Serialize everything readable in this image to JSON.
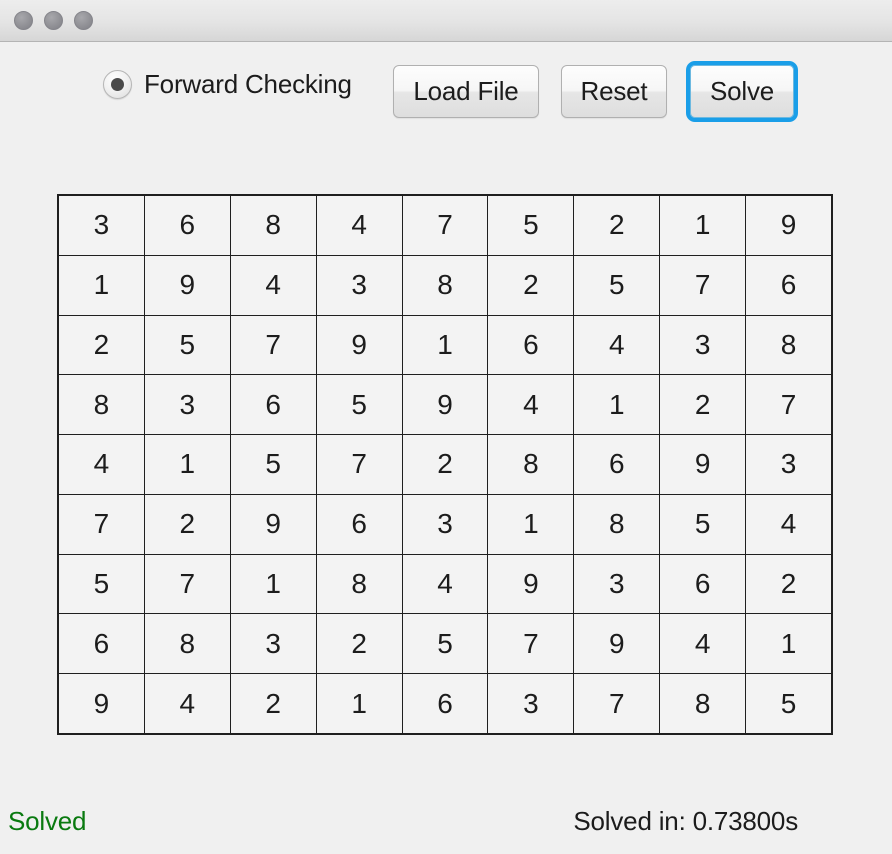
{
  "window": {
    "traffic_lights": [
      {
        "name": "close-button",
        "color": "#909095"
      },
      {
        "name": "minimize-button",
        "color": "#909095"
      },
      {
        "name": "zoom-button",
        "color": "#909095"
      }
    ]
  },
  "toolbar": {
    "radio": {
      "label": "Forward Checking",
      "selected": true
    },
    "buttons": [
      {
        "id": "load-file",
        "label": "Load File",
        "focused": false
      },
      {
        "id": "reset",
        "label": "Reset",
        "focused": false
      },
      {
        "id": "solve",
        "label": "Solve",
        "focused": true
      }
    ],
    "focus_ring_color": "#1a9ee8"
  },
  "grid": {
    "rows": [
      [
        "3",
        "6",
        "8",
        "4",
        "7",
        "5",
        "2",
        "1",
        "9"
      ],
      [
        "1",
        "9",
        "4",
        "3",
        "8",
        "2",
        "5",
        "7",
        "6"
      ],
      [
        "2",
        "5",
        "7",
        "9",
        "1",
        "6",
        "4",
        "3",
        "8"
      ],
      [
        "8",
        "3",
        "6",
        "5",
        "9",
        "4",
        "1",
        "2",
        "7"
      ],
      [
        "4",
        "1",
        "5",
        "7",
        "2",
        "8",
        "6",
        "9",
        "3"
      ],
      [
        "7",
        "2",
        "9",
        "6",
        "3",
        "1",
        "8",
        "5",
        "4"
      ],
      [
        "5",
        "7",
        "1",
        "8",
        "4",
        "9",
        "3",
        "6",
        "2"
      ],
      [
        "6",
        "8",
        "3",
        "2",
        "5",
        "7",
        "9",
        "4",
        "1"
      ],
      [
        "9",
        "4",
        "2",
        "1",
        "6",
        "3",
        "7",
        "8",
        "5"
      ]
    ],
    "cell_background": "#f3f3f3",
    "line_color": "#1f1f1f"
  },
  "status": {
    "left_text": "Solved",
    "left_color": "#0a7a10",
    "right_text": "Solved in: 0.73800s",
    "right_color": "#1c1c1c"
  }
}
